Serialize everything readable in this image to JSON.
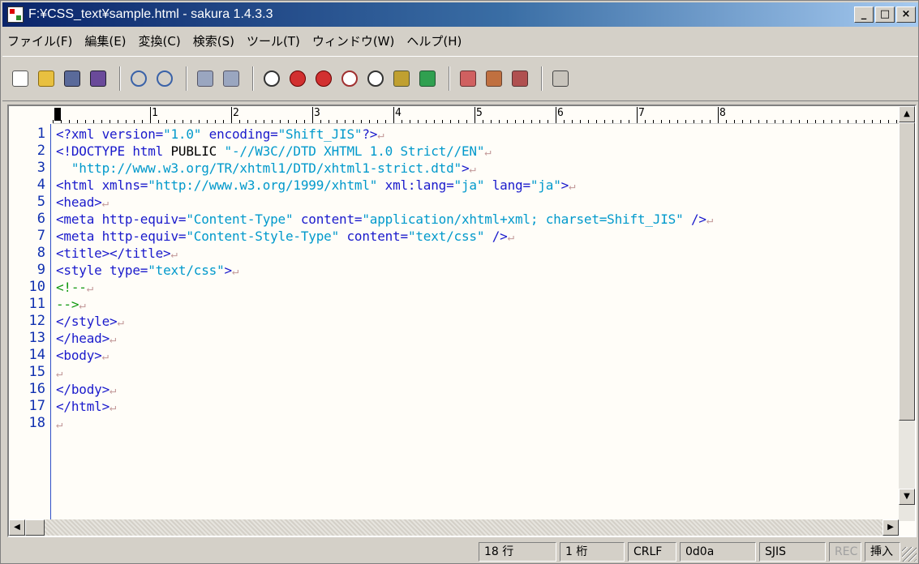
{
  "window": {
    "title": "F:¥CSS_text¥sample.html - sakura 1.4.3.3",
    "controls": {
      "minimize": "_",
      "maximize": "□",
      "close": "×"
    }
  },
  "menu": [
    "ファイル(F)",
    "編集(E)",
    "変換(C)",
    "検索(S)",
    "ツール(T)",
    "ウィンドウ(W)",
    "ヘルプ(H)"
  ],
  "toolbar": {
    "groups": [
      [
        "new-file-icon",
        "open-folder-icon",
        "save-icon",
        "save-all-icon"
      ],
      [
        "undo-icon",
        "redo-icon"
      ],
      [
        "jump-back-icon",
        "jump-forward-icon"
      ],
      [
        "search-icon",
        "search-down-icon",
        "search-up-icon",
        "replace-icon",
        "search-highlight-icon",
        "grep-icon",
        "tag-jump-icon"
      ],
      [
        "compare-icon",
        "diff-icon",
        "outline-icon"
      ],
      [
        "settings-icon"
      ]
    ]
  },
  "ruler": {
    "marks": [
      "1",
      "2",
      "3",
      "4",
      "5",
      "6",
      "7",
      "8"
    ]
  },
  "editor": {
    "line_numbers": [
      "1",
      "2",
      "3",
      "4",
      "5",
      "6",
      "7",
      "8",
      "9",
      "10",
      "11",
      "12",
      "13",
      "14",
      "15",
      "16",
      "17",
      "18"
    ],
    "eol_mark": "↵",
    "lines": [
      [
        {
          "t": "tag",
          "v": "<?xml version="
        },
        {
          "t": "str",
          "v": "\"1.0\""
        },
        {
          "t": "tag",
          "v": " encoding="
        },
        {
          "t": "str",
          "v": "\"Shift_JIS\""
        },
        {
          "t": "tag",
          "v": "?>"
        }
      ],
      [
        {
          "t": "tag",
          "v": "<!DOCTYPE html "
        },
        {
          "t": "plain",
          "v": "PUBLIC "
        },
        {
          "t": "str",
          "v": "\"-//W3C//DTD XHTML 1.0 Strict//EN\""
        }
      ],
      [
        {
          "t": "str",
          "v": "  \"http://www.w3.org/TR/xhtml1/DTD/xhtml1-strict.dtd\""
        },
        {
          "t": "tag",
          "v": ">"
        }
      ],
      [
        {
          "t": "tag",
          "v": "<html xmlns="
        },
        {
          "t": "str",
          "v": "\"http://www.w3.org/1999/xhtml\""
        },
        {
          "t": "tag",
          "v": " xml:lang="
        },
        {
          "t": "str",
          "v": "\"ja\""
        },
        {
          "t": "tag",
          "v": " lang="
        },
        {
          "t": "str",
          "v": "\"ja\""
        },
        {
          "t": "tag",
          "v": ">"
        }
      ],
      [
        {
          "t": "tag",
          "v": "<head>"
        }
      ],
      [
        {
          "t": "tag",
          "v": "<meta http-equiv="
        },
        {
          "t": "str",
          "v": "\"Content-Type\""
        },
        {
          "t": "tag",
          "v": " content="
        },
        {
          "t": "str",
          "v": "\"application/xhtml+xml; charset=Shift_JIS\""
        },
        {
          "t": "tag",
          "v": " />"
        }
      ],
      [
        {
          "t": "tag",
          "v": "<meta http-equiv="
        },
        {
          "t": "str",
          "v": "\"Content-Style-Type\""
        },
        {
          "t": "tag",
          "v": " content="
        },
        {
          "t": "str",
          "v": "\"text/css\""
        },
        {
          "t": "tag",
          "v": " />"
        }
      ],
      [
        {
          "t": "tag",
          "v": "<title></title>"
        }
      ],
      [
        {
          "t": "tag",
          "v": "<style type="
        },
        {
          "t": "str",
          "v": "\"text/css\""
        },
        {
          "t": "tag",
          "v": ">"
        }
      ],
      [
        {
          "t": "cmt",
          "v": "<!--"
        }
      ],
      [
        {
          "t": "cmt",
          "v": "-->"
        }
      ],
      [
        {
          "t": "tag",
          "v": "</style>"
        }
      ],
      [
        {
          "t": "tag",
          "v": "</head>"
        }
      ],
      [
        {
          "t": "tag",
          "v": "<body>"
        }
      ],
      [],
      [
        {
          "t": "tag",
          "v": "</body>"
        }
      ],
      [
        {
          "t": "tag",
          "v": "</html>"
        }
      ],
      []
    ]
  },
  "status": {
    "row": "18 行",
    "col": "1 桁",
    "eol": "CRLF",
    "code": "0d0a",
    "encoding": "SJIS",
    "rec": "REC",
    "mode": "挿入"
  },
  "colors": {
    "tag": "#1a1acc",
    "string": "#0099cc",
    "comment": "#119911",
    "line_number": "#1030b0",
    "eol": "#c39a9a"
  }
}
